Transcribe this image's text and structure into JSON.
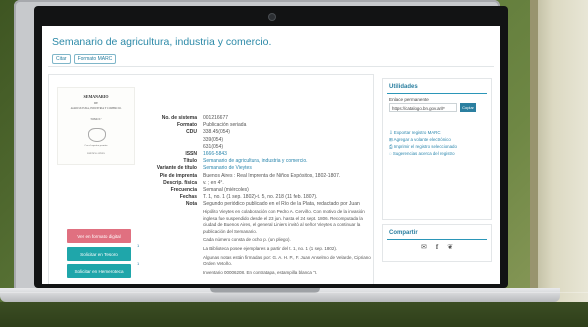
{
  "page": {
    "title": "Semanario de agricultura, industria y comercio.",
    "buttons": [
      "Citar",
      "Formato MARC"
    ]
  },
  "thumbnail": {
    "line1": "SEMANARIO",
    "line2": "DE",
    "line3": "AGRICULTURA, INDUSTRIA Y COMERCIO.",
    "line4": "TOMO I.º",
    "line5": "Con el superior permiso",
    "line6": "BUENOS AYRES"
  },
  "actions": {
    "digital": "Ver en formato digital",
    "tesoro": "Solicitar en Tesoro",
    "hemeroteca": "Solicitar en Hemeroteca"
  },
  "fields": [
    {
      "label": "No. de sistema",
      "value": "001216677"
    },
    {
      "label": "Formato",
      "value": "Publicación seriada"
    },
    {
      "label": "CDU",
      "value": "338.45(054)"
    },
    {
      "label": "",
      "value": "339(054)"
    },
    {
      "label": "",
      "value": "631(054)"
    },
    {
      "label": "ISSN",
      "value": "1666-5843",
      "link": true
    },
    {
      "label": "Título",
      "value": "Semanario de agricultura, industria y comercio.",
      "link": true
    },
    {
      "label": "Variante de título",
      "value": "Semanario de Vieytes",
      "link": true
    },
    {
      "label": "Pie de imprenta",
      "value": "Buenos Aires : Real Imprenta de Niños Expósitos, 1802-1807."
    },
    {
      "label": "Descrip. física",
      "value": "v. ; en 4°."
    },
    {
      "label": "Frecuencia",
      "value": "Semanal (miércoles)"
    },
    {
      "label": "Fechas",
      "value": "T. 1, no. 1 (1 sep. 1802)-t. 5, no. 218 (11 feb. 1807)."
    },
    {
      "label": "Nota",
      "value": "Segundo periódico publicado en el Río de la Plata, redactado por Juan"
    }
  ],
  "notes": [
    "Hipólito Vieytes en colaboración con Pedro A. Cerviño. Con motivo de la invasión inglesa fue suspendido desde el 23 jun. hasta el 24 sept. 1806. Recomputada la ciudad de Buenos Aires, el general Liniers invitó al señor Vieytes a continuar la publicación del Semanario.",
    "Cada número consta de ocho p. (un pliego).",
    "La Biblioteca posee ejemplares a partir del t. 1, no. 1 (1 sep. 1802).",
    "Algunas notas están firmadas por: G. A. H. P., F. Juan Anselmo de Velarde, Cipriano Orden Vetoño.",
    "Inventario 00006208. En contratapa, estampilla blanca \"I."
  ],
  "markers": {
    "m1": "1",
    "m2": "1"
  },
  "sidebar": {
    "title": "Utilidades",
    "permalink_label": "Enlace permanente",
    "permalink_value": "https://catalogo.bn.gov.ar/F",
    "copy_label": "Copiar",
    "links": [
      "Exportar registro MARC",
      "Agregar a volante electrónico",
      "Imprimir el registro seleccionado",
      "Sugerencias acerca del registro"
    ]
  },
  "share": {
    "title": "Compartir",
    "icons": [
      "email-icon",
      "facebook-icon",
      "twitter-icon"
    ]
  }
}
